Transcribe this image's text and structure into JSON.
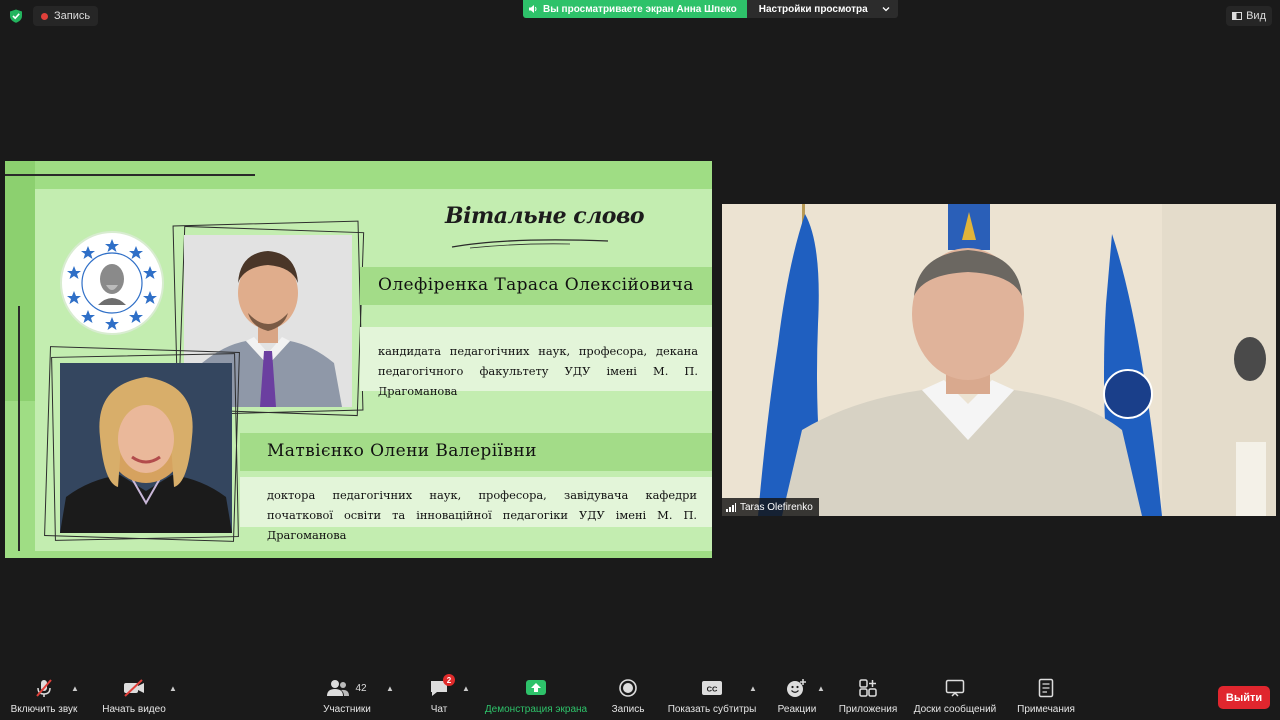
{
  "topbar": {
    "recording_label": "Запись",
    "share_banner": "Вы просматриваете экран Анна Шпеко",
    "view_options": "Настройки просмотра",
    "view_button": "Вид"
  },
  "slide": {
    "title": "Вітальне слово",
    "person1": {
      "name": "Олефіренка Тараса Олексійовича",
      "description": "кандидата педагогічних наук, професора, декана педагогічного факультету УДУ імені М. П. Драгоманова"
    },
    "person2": {
      "name": "Матвієнко Олени Валеріївни",
      "description": "доктора педагогічних наук, професора, завідувача кафедри початкової освіти та інноваційної педагогіки УДУ імені М. П. Драгоманова"
    }
  },
  "video": {
    "participant_name": "Taras Olefirenko"
  },
  "toolbar": {
    "unmute": "Включить звук",
    "start_video": "Начать видео",
    "participants": "Участники",
    "participants_count": "42",
    "chat": "Чат",
    "chat_badge": "2",
    "share_screen": "Демонстрация экрана",
    "record": "Запись",
    "captions": "Показать субтитры",
    "reactions": "Реакции",
    "apps": "Приложения",
    "whiteboards": "Доски сообщений",
    "notes": "Примечания",
    "leave": "Выйти"
  },
  "colors": {
    "accent_green": "#2ec26a",
    "leave_red": "#e0262e",
    "slide_green": "#9fdd84"
  }
}
